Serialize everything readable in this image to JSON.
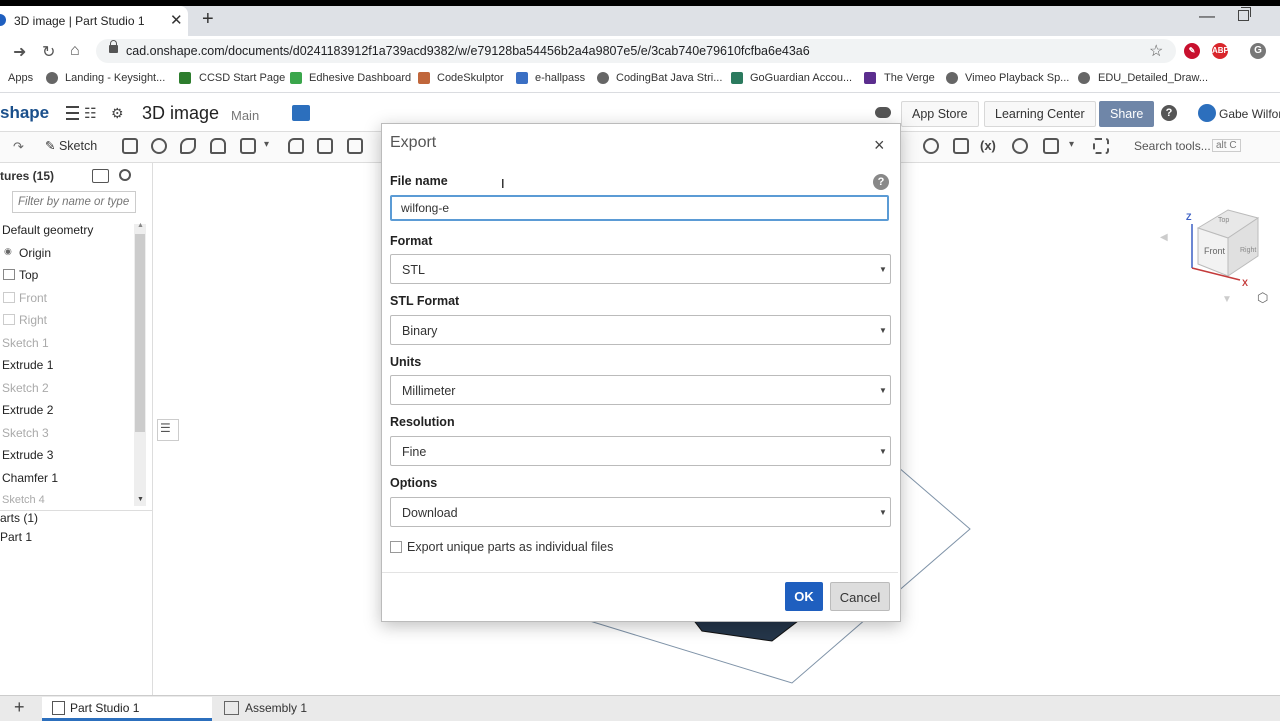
{
  "browser": {
    "tab_title": "3D image | Part Studio 1",
    "url": "cad.onshape.com/documents/d0241183912f1a739acd9382/w/e79128ba54456b2a4a9807e5/e/3cab740e79610fcfba6e43a6",
    "bookmarks": [
      "Apps",
      "Landing - Keysight...",
      "CCSD Start Page",
      "Edhesive Dashboard",
      "CodeSkulptor",
      "e-hallpass",
      "CodingBat Java Stri...",
      "GoGuardian Accou...",
      "The Verge",
      "Vimeo Playback Sp...",
      "EDU_Detailed_Draw..."
    ],
    "ext_abp": "ABP",
    "profile_initial": "G"
  },
  "app": {
    "logo": "shape",
    "doc_title": "3D image",
    "branch": "Main",
    "app_store": "App Store",
    "learning_center": "Learning Center",
    "share": "Share",
    "user": "Gabe Wilfor",
    "help": "?"
  },
  "toolbar": {
    "sketch": "Sketch",
    "search_tools": "Search tools...",
    "search_kbd": "alt C"
  },
  "features": {
    "heading": "tures (15)",
    "filter_placeholder": "Filter by name or type",
    "items": [
      {
        "label": "Default geometry"
      },
      {
        "label": "Origin"
      },
      {
        "label": "Top"
      },
      {
        "label": "Front"
      },
      {
        "label": "Right"
      },
      {
        "label": "Sketch 1"
      },
      {
        "label": "Extrude 1"
      },
      {
        "label": "Sketch 2"
      },
      {
        "label": "Extrude 2"
      },
      {
        "label": "Sketch 3"
      },
      {
        "label": "Extrude 3"
      },
      {
        "label": "Chamfer 1"
      },
      {
        "label": "Sketch 4"
      }
    ],
    "parts_heading": "arts (1)",
    "part": "Part 1"
  },
  "view_cube": {
    "top": "Top",
    "front": "Front",
    "right": "Right",
    "z": "Z",
    "x": "X"
  },
  "bottom_tabs": {
    "part_studio": "Part Studio 1",
    "assembly": "Assembly 1"
  },
  "dialog": {
    "title": "Export",
    "close": "×",
    "file_name_label": "File name",
    "file_name_value": "wilfong-e",
    "format_label": "Format",
    "format_value": "STL",
    "stl_format_label": "STL Format",
    "stl_format_value": "Binary",
    "units_label": "Units",
    "units_value": "Millimeter",
    "resolution_label": "Resolution",
    "resolution_value": "Fine",
    "options_label": "Options",
    "options_value": "Download",
    "checkbox_label": "Export unique parts as individual files",
    "ok": "OK",
    "cancel": "Cancel"
  }
}
